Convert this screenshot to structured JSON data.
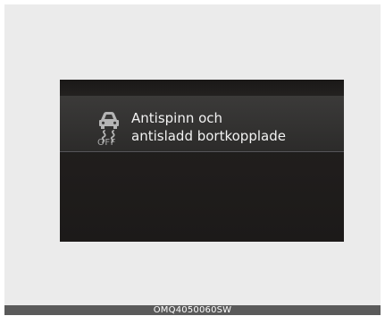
{
  "display": {
    "message": {
      "icon": "esc-off-skid-car-icon",
      "icon_text": "OFF",
      "line1": "Antispinn och",
      "line2": "antisladd bortkopplade"
    }
  },
  "caption": {
    "code": "OMQ4050060SW"
  },
  "colors": {
    "frame_background": "#ebebeb",
    "display_background": "#211e1d",
    "message_panel": "#353433",
    "text": "#f2f2f2",
    "caption_bar": "#5a5a5a"
  }
}
